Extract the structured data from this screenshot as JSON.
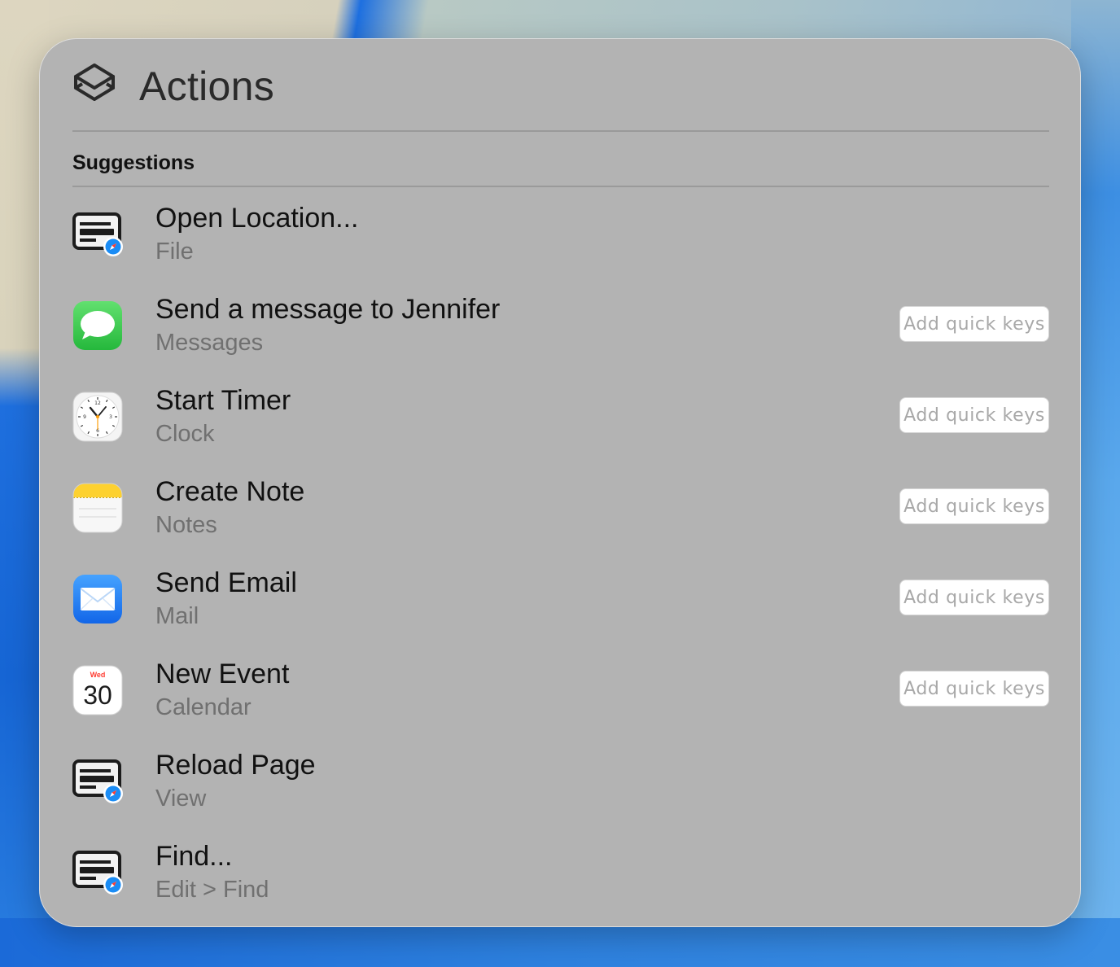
{
  "panel": {
    "title": "Actions",
    "section_title": "Suggestions"
  },
  "actions": [
    {
      "title": "Open Location...",
      "subtitle": "File",
      "icon": "menu-item-safari-icon",
      "quick_keys": ""
    },
    {
      "title": "Send a message to Jennifer",
      "subtitle": "Messages",
      "icon": "messages-app-icon",
      "quick_keys": "Add quick keys"
    },
    {
      "title": "Start Timer",
      "subtitle": "Clock",
      "icon": "clock-app-icon",
      "quick_keys": "Add quick keys"
    },
    {
      "title": "Create Note",
      "subtitle": "Notes",
      "icon": "notes-app-icon",
      "quick_keys": "Add quick keys"
    },
    {
      "title": "Send Email",
      "subtitle": "Mail",
      "icon": "mail-app-icon",
      "quick_keys": "Add quick keys"
    },
    {
      "title": "New Event",
      "subtitle": "Calendar",
      "icon": "calendar-app-icon",
      "quick_keys": "Add quick keys"
    },
    {
      "title": "Reload Page",
      "subtitle": "View",
      "icon": "menu-item-safari-icon",
      "quick_keys": ""
    },
    {
      "title": "Find...",
      "subtitle": "Edit > Find",
      "icon": "menu-item-safari-icon",
      "quick_keys": ""
    }
  ],
  "calendar_icon": {
    "weekday": "Wed",
    "day": "30"
  },
  "clock_icon": {
    "n12": "12",
    "n3": "3",
    "n6": "6",
    "n9": "9"
  },
  "colors": {
    "panel_bg": "#b3b3b3",
    "messages_green": "#34c759",
    "mail_blue": "#1f7cf5",
    "notes_yellow": "#fdd12f",
    "calendar_red": "#ff3b30"
  }
}
